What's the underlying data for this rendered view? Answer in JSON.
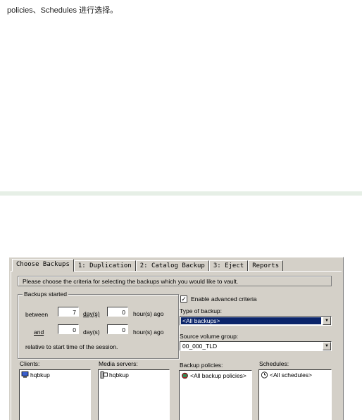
{
  "document": {
    "intro_text": "policies、Schedules 进行选择。"
  },
  "dialog": {
    "tabs": [
      "Choose Backups",
      "1: Duplication",
      "2: Catalog Backup",
      "3: Eject",
      "Reports"
    ],
    "active_tab": "Choose Backups",
    "message": "Please choose the criteria for selecting the backups which you would like to vault.",
    "backups_started": {
      "legend": "Backups started",
      "between_label": "between",
      "between_days": "7",
      "between_days_unit": "day(s)",
      "between_hours": "0",
      "between_hours_unit": "hour(s) ago",
      "and_label": "and",
      "and_days": "0",
      "and_days_unit": "day(s)",
      "and_hours": "0",
      "and_hours_unit": "hour(s) ago",
      "relative_note": "relative to start time of the session."
    },
    "advanced": {
      "enable_label": "Enable advanced criteria",
      "enabled": true,
      "type_label": "Type of backup:",
      "type_value": "<All backups>",
      "volume_group_label": "Source volume group:",
      "volume_group_value": "00_000_TLD"
    },
    "lists": {
      "clients_label": "Clients:",
      "clients": [
        "hqbkup"
      ],
      "media_servers_label": "Media servers:",
      "media_servers": [
        "hqbkup"
      ],
      "policies_label": "Backup policies:",
      "policies": [
        "<All backup policies>"
      ],
      "schedules_label": "Schedules:",
      "schedules": [
        "<All schedules>"
      ]
    }
  },
  "icons": {
    "client": "computer-icon",
    "media_server": "server-icon",
    "policy": "policy-icon",
    "schedule": "schedule-icon"
  },
  "colors": {
    "dialog_bg": "#d4d0c8",
    "selection": "#0a246a",
    "divider": "#e6efe6"
  }
}
